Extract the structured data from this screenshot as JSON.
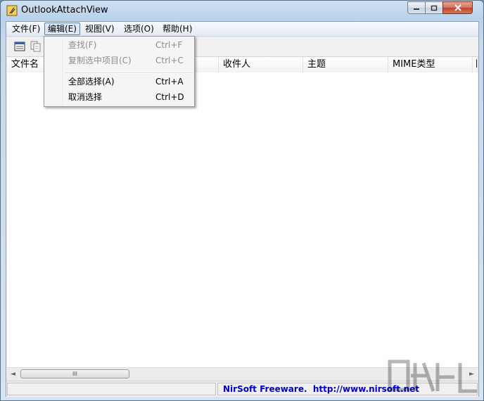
{
  "window": {
    "title": "OutlookAttachView"
  },
  "menubar": {
    "items": [
      {
        "label": "文件(F)"
      },
      {
        "label": "编辑(E)"
      },
      {
        "label": "视图(V)"
      },
      {
        "label": "选项(O)"
      },
      {
        "label": "帮助(H)"
      }
    ],
    "active_index": 1
  },
  "toolbar": {
    "buttons": [
      "properties-icon",
      "copy-icon"
    ]
  },
  "edit_menu": {
    "items": [
      {
        "label": "查找(F)",
        "shortcut": "Ctrl+F",
        "enabled": false
      },
      {
        "label": "复制选中项目(C)",
        "shortcut": "Ctrl+C",
        "enabled": false
      },
      {
        "label": "全部选择(A)",
        "shortcut": "Ctrl+A",
        "enabled": true
      },
      {
        "label": "取消选择",
        "shortcut": "Ctrl+D",
        "enabled": true
      }
    ]
  },
  "table": {
    "columns": [
      "文件名",
      "",
      "收件人",
      "主题",
      "MIME类型",
      "附"
    ]
  },
  "scrollbar": {
    "thumb_glyph": "III",
    "left_arrow": "◄",
    "right_arrow": "►"
  },
  "statusbar": {
    "text": "NirSoft Freeware.  http://www.nirsoft.net"
  },
  "colors": {
    "status_link": "#0000cc",
    "close_button": "#c1432a"
  }
}
